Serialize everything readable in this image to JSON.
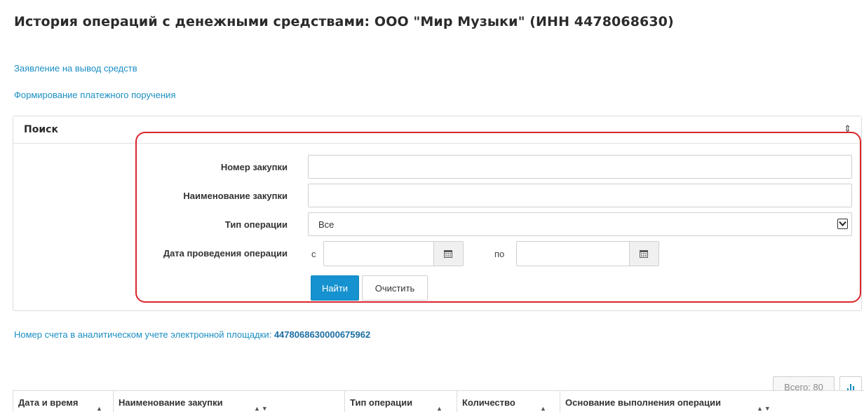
{
  "page": {
    "title": "История операций с денежными средствами: ООО \"Мир Музыки\" (ИНН 4478068630)"
  },
  "links": {
    "withdraw": "Заявление на вывод средств",
    "payment_order": "Формирование платежного поручения"
  },
  "search": {
    "title": "Поиск",
    "toggle_icon": "vertical-arrows-icon",
    "fields": {
      "purchase_number_label": "Номер закупки",
      "purchase_number_value": "",
      "purchase_name_label": "Наименование закупки",
      "purchase_name_value": "",
      "operation_type_label": "Тип операции",
      "operation_type_value": "Все",
      "date_label": "Дата проведения операции",
      "date_from_prefix": "с",
      "date_from_value": "",
      "date_to_prefix": "по",
      "date_to_value": ""
    },
    "buttons": {
      "find": "Найти",
      "clear": "Очистить"
    },
    "highlight_color": "#d9262c"
  },
  "account": {
    "label": "Номер счета в аналитическом учете электронной площадки: ",
    "number": "4478068630000675962"
  },
  "table": {
    "total": "Всего: 80",
    "columns": [
      "Дата и время",
      "Наименование закупки",
      "Тип операции",
      "Количество",
      "Основание выполнения операции"
    ]
  },
  "colors": {
    "link": "#1b8fc3",
    "primary_button": "#1592cf",
    "highlight": "#d9262c"
  }
}
